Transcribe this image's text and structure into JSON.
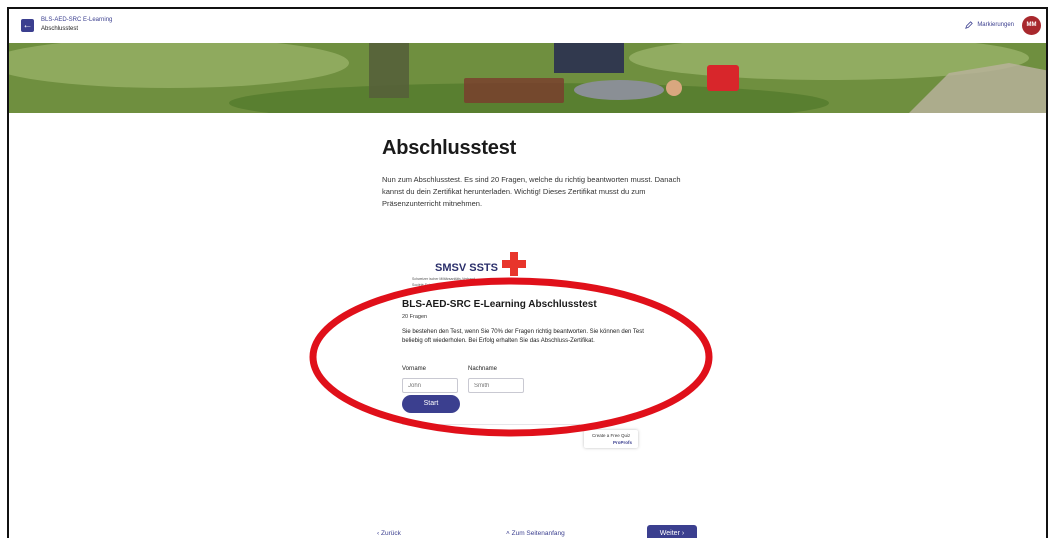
{
  "header": {
    "course_title": "BLS-AED-SRC E-Learning",
    "page_subtitle": "Abschlusstest",
    "markings_label": "Markierungen",
    "avatar_initials": "MM"
  },
  "main": {
    "title": "Abschlusstest",
    "intro": "Nun zum Abschlusstest. Es sind 20 Fragen, welche du richtig beantworten musst. Danach kannst du dein Zertifikat herunterladen. Wichtig! Dieses Zertifikat musst du zum Präsenzunterricht mitnehmen."
  },
  "quiz": {
    "logo_text": "SMSV SSTS",
    "logo_line1": "Schweizer ischer Militärsanitäts-Verband",
    "logo_line2": "Société Suisse des Troupes Sanitaires",
    "title": "BLS-AED-SRC E-Learning Abschlusstest",
    "question_count": "20 Fragen",
    "description": "Sie bestehen den Test, wenn Sie 70% der Fragen richtig beantworten. Sie können den Test beliebig oft wiederholen. Bei Erfolg erhalten Sie das Abschluss-Zertifikat.",
    "firstname_label": "Vorname",
    "firstname_placeholder": "John",
    "lastname_label": "Nachname",
    "lastname_placeholder": "Smith",
    "start_label": "Start",
    "badge_line1": "Create a Free Quiz",
    "badge_line2": "ProProfs"
  },
  "footer": {
    "prev_label": "Zurück",
    "top_label": "Zum Seitenanfang",
    "next_label": "Weiter"
  },
  "colors": {
    "accent": "#3b3f8f",
    "avatar": "#a8282d",
    "annotation_red": "#e0101a",
    "cross_red": "#e8352b"
  },
  "icons": [
    "arrow-left-icon",
    "pencil-icon",
    "chevron-left-icon",
    "chevron-up-icon",
    "chevron-right-icon",
    "red-cross-icon"
  ]
}
